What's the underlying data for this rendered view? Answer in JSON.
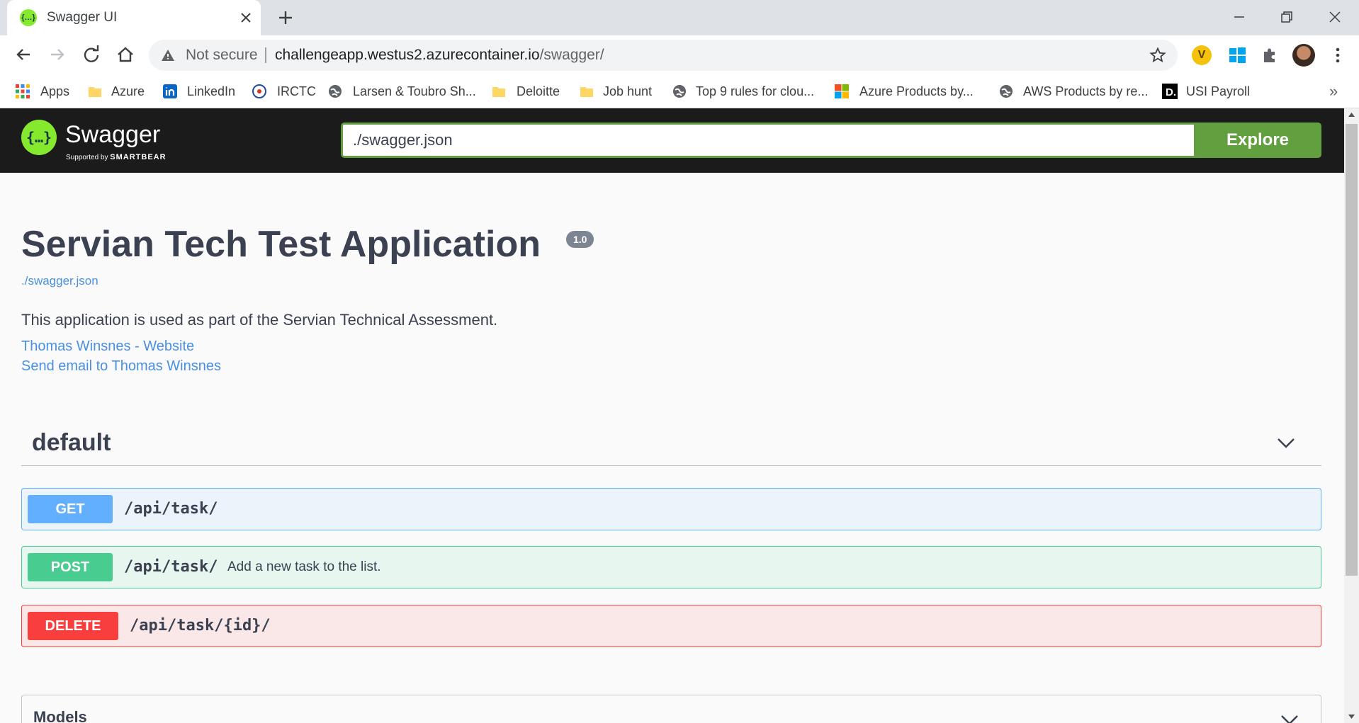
{
  "browser": {
    "tab_title": "Swagger UI",
    "security_label": "Not secure",
    "url_host": "challengeapp.westus2.azurecontainer.io",
    "url_path": "/swagger/"
  },
  "bookmarks": [
    {
      "label": "Apps",
      "icon": "apps-grid-icon"
    },
    {
      "label": "Azure",
      "icon": "folder-icon"
    },
    {
      "label": "LinkedIn",
      "icon": "linkedin-icon"
    },
    {
      "label": "IRCTC",
      "icon": "irctc-icon"
    },
    {
      "label": "Larsen & Toubro Sh...",
      "icon": "globe-icon"
    },
    {
      "label": "Deloitte",
      "icon": "folder-icon"
    },
    {
      "label": "Job hunt",
      "icon": "folder-icon"
    },
    {
      "label": "Top 9 rules for clou...",
      "icon": "globe-icon"
    },
    {
      "label": "Azure Products by...",
      "icon": "microsoft-icon"
    },
    {
      "label": "AWS Products by re...",
      "icon": "globe-icon"
    },
    {
      "label": "USI Payroll",
      "icon": "d-logo-icon"
    }
  ],
  "swagger": {
    "logo_text": "Swagger",
    "supported_by": "Supported by",
    "smartbear": "SMARTBEAR",
    "url_value": "./swagger.json",
    "explore_label": "Explore"
  },
  "info": {
    "title": "Servian Tech Test Application",
    "version": "1.0",
    "spec_url": "./swagger.json",
    "description": "This application is used as part of the Servian Technical Assessment.",
    "website_link": "Thomas Winsnes - Website",
    "email_link": "Send email to Thomas Winsnes"
  },
  "tag": {
    "name": "default"
  },
  "operations": [
    {
      "method": "GET",
      "path": "/api/task/",
      "summary": ""
    },
    {
      "method": "POST",
      "path": "/api/task/",
      "summary": "Add a new task to the list."
    },
    {
      "method": "DELETE",
      "path": "/api/task/{id}/",
      "summary": ""
    }
  ],
  "models": {
    "title": "Models"
  },
  "colors": {
    "get": "#61affe",
    "post": "#49cc90",
    "delete": "#f93e3e",
    "swagger_green": "#62a03f",
    "link": "#4990e2"
  }
}
